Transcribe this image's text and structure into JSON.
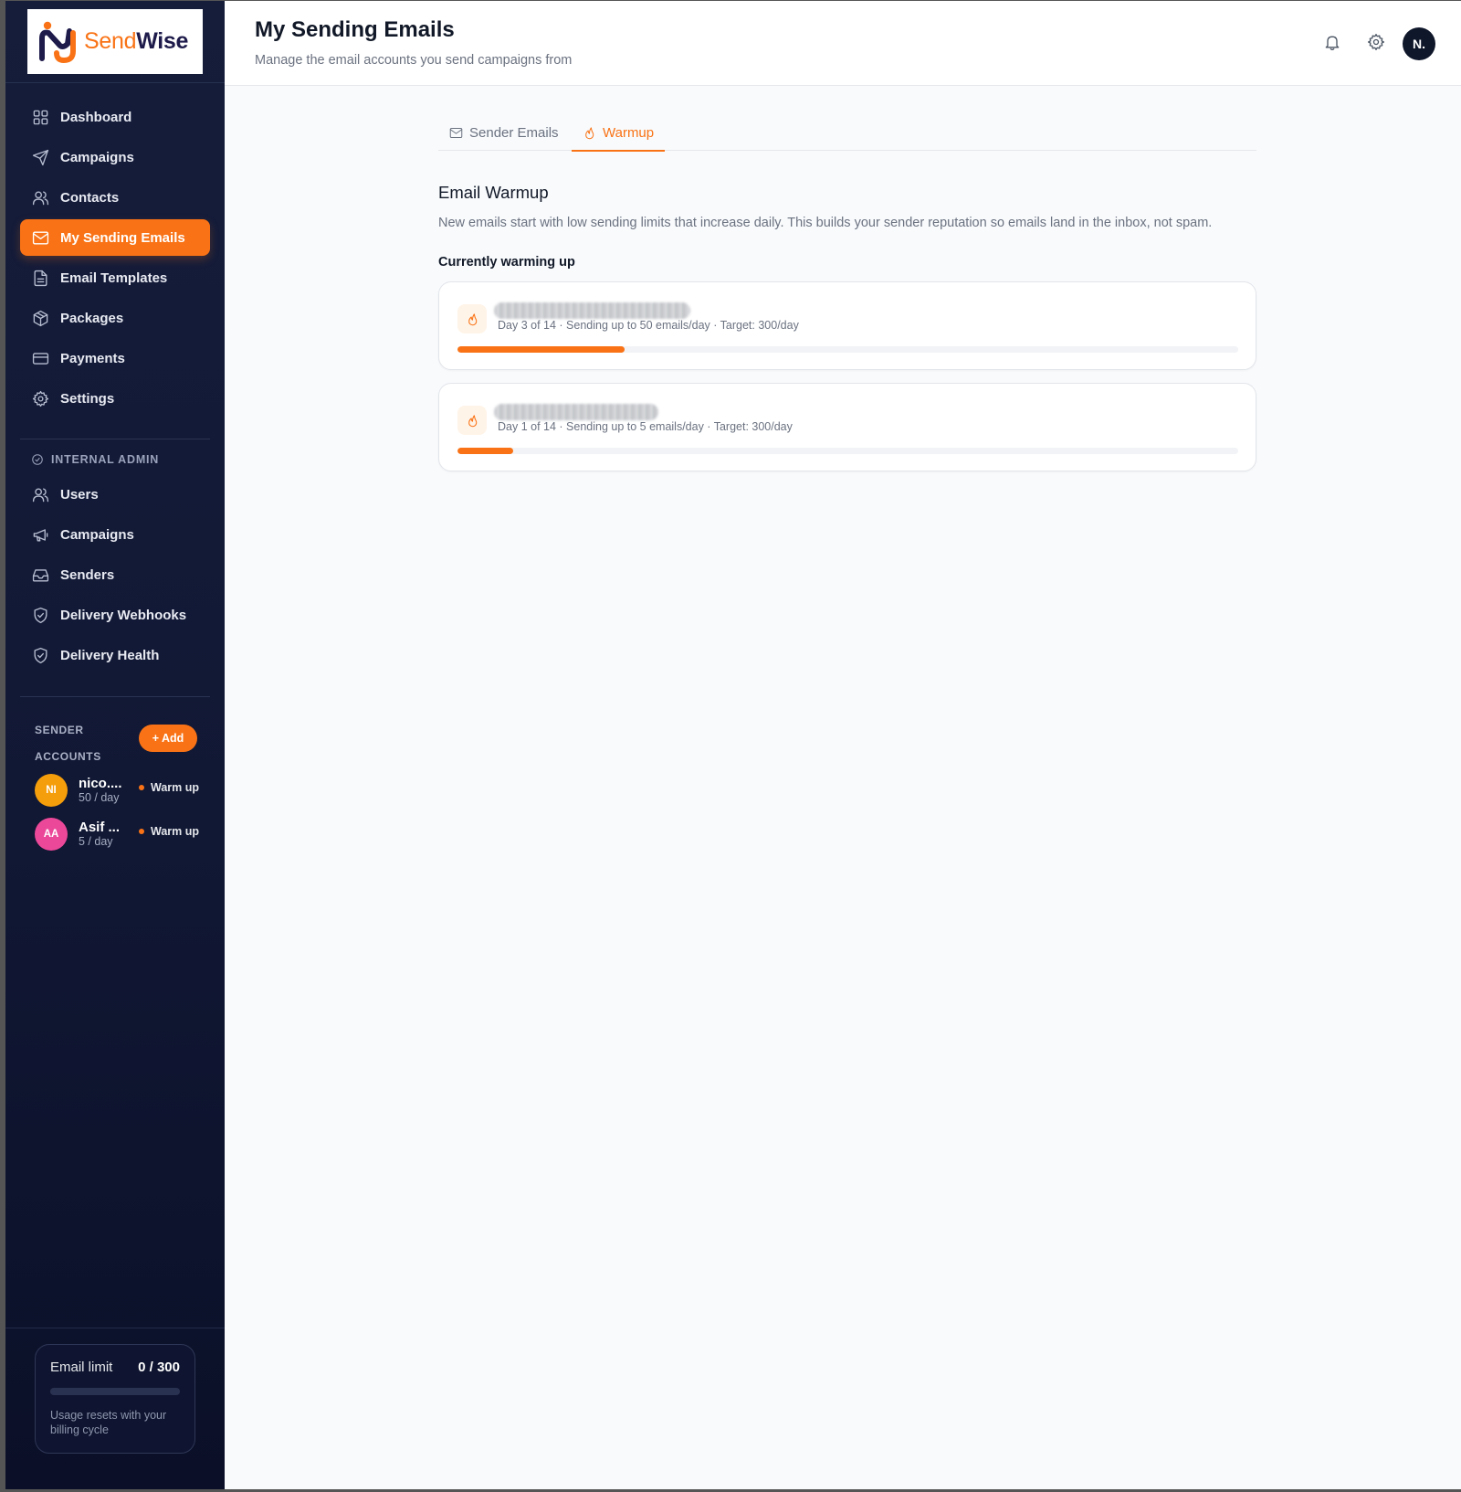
{
  "brand": {
    "send": "Send",
    "wise": "Wise",
    "accent": "#f97316",
    "sidebar_bg": "#111834"
  },
  "nav": [
    {
      "label": "Dashboard",
      "icon": "grid-icon"
    },
    {
      "label": "Campaigns",
      "icon": "send-icon"
    },
    {
      "label": "Contacts",
      "icon": "users-icon"
    },
    {
      "label": "My Sending Emails",
      "icon": "mail-icon",
      "active": true
    },
    {
      "label": "Email Templates",
      "icon": "file-text-icon"
    },
    {
      "label": "Packages",
      "icon": "package-icon"
    },
    {
      "label": "Payments",
      "icon": "credit-card-icon"
    },
    {
      "label": "Settings",
      "icon": "gear-icon"
    }
  ],
  "admin": {
    "heading": "INTERNAL ADMIN",
    "items": [
      {
        "label": "Users",
        "icon": "users-icon"
      },
      {
        "label": "Campaigns",
        "icon": "megaphone-icon"
      },
      {
        "label": "Senders",
        "icon": "inbox-icon"
      },
      {
        "label": "Delivery Webhooks",
        "icon": "shield-check-icon"
      },
      {
        "label": "Delivery Health",
        "icon": "shield-check-icon"
      }
    ]
  },
  "sender_accounts": {
    "heading_line1": "SENDER",
    "heading_line2": "ACCOUNTS",
    "add_label": "+ Add",
    "accounts": [
      {
        "initials": "NI",
        "name": "nico....",
        "rate": "50 / day",
        "status": "Warm up",
        "color": "#f59e0b"
      },
      {
        "initials": "AA",
        "name": "Asif ...",
        "rate": "5 / day",
        "status": "Warm up",
        "color": "#ec4899"
      }
    ]
  },
  "email_limit": {
    "label": "Email limit",
    "value": "0 / 300",
    "used_fraction": 0,
    "note": "Usage resets with your billing cycle"
  },
  "header": {
    "title": "My Sending Emails",
    "subtitle": "Manage the email accounts you send campaigns from",
    "notification_icon": "bell-icon",
    "settings_icon": "gear-icon",
    "avatar": "N."
  },
  "tabs": [
    {
      "label": "Sender Emails",
      "icon": "mail-icon"
    },
    {
      "label": "Warmup",
      "icon": "flame-icon",
      "active": true
    }
  ],
  "warmup": {
    "title": "Email Warmup",
    "description": "New emails start with low sending limits that increase daily. This builds your sender reputation so emails land in the inbox, not spam.",
    "subtitle": "Currently warming up",
    "items": [
      {
        "email": "",
        "meta": "Day 3 of 14 · Sending up to 50 emails/day · Target: 300/day",
        "progress": 0.214
      },
      {
        "email": "",
        "meta": "Day 1 of 14 · Sending up to 5 emails/day · Target: 300/day",
        "progress": 0.071
      }
    ]
  }
}
